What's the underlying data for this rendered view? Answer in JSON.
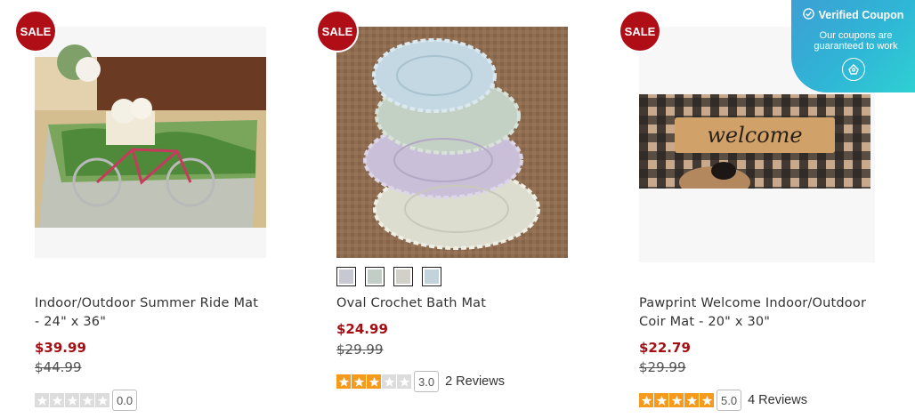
{
  "coupon": {
    "title": "Verified Coupon",
    "subtitle_line1": "Our coupons are",
    "subtitle_line2": "guaranteed to work",
    "icon": "check-circle-icon"
  },
  "products": [
    {
      "badge": "SALE",
      "title_line1": "Indoor/Outdoor Summer Ride Mat",
      "title_line2": "- 24\" x 36\"",
      "price": "$39.99",
      "original_price": "$44.99",
      "rating": 0,
      "score": "0.0",
      "reviews": ""
    },
    {
      "badge": "SALE",
      "title_line1": "Oval Crochet Bath Mat",
      "title_line2": "",
      "price": "$24.99",
      "original_price": "$29.99",
      "rating": 3,
      "score": "3.0",
      "reviews": "2 Reviews",
      "swatches": [
        "#c7c9d2",
        "#c2cdc6",
        "#d2d0c8",
        "#c2d3dc"
      ]
    },
    {
      "badge": "SALE",
      "title_line1": "Pawprint Welcome Indoor/Outdoor",
      "title_line2": "Coir Mat - 20\" x 30\"",
      "price": "$22.79",
      "original_price": "$29.99",
      "rating": 5,
      "score": "5.0",
      "reviews": "4 Reviews",
      "mat_text": "welcome"
    }
  ]
}
